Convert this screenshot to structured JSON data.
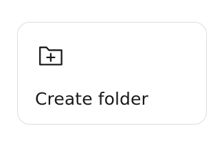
{
  "card": {
    "label": "Create folder",
    "icon": "folder-plus-icon"
  },
  "colors": {
    "text": "#1a1a1a",
    "border": "#dddddd",
    "background": "#ffffff"
  }
}
